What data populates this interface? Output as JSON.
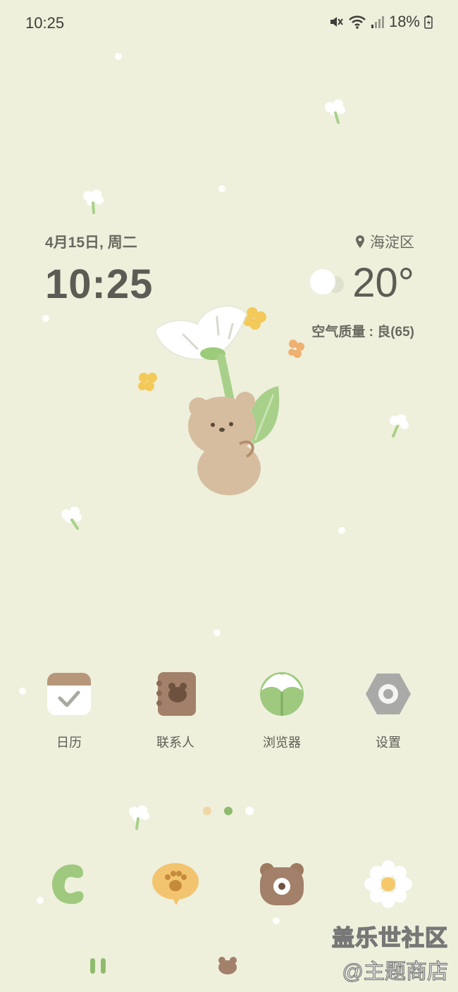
{
  "status_bar": {
    "time": "10:25",
    "battery": "18%",
    "icons": [
      "mute-icon",
      "wifi-icon",
      "signal-icon",
      "battery-charging-icon"
    ]
  },
  "widget": {
    "date": "4月15日, 周二",
    "time": "10:25",
    "location": "海淀区",
    "temperature": "20°",
    "air_quality": "空气质量 : 良(65)",
    "weather_icon": "partly-cloudy-icon"
  },
  "apps": [
    {
      "label": "日历",
      "icon": "calendar-icon"
    },
    {
      "label": "联系人",
      "icon": "contacts-icon"
    },
    {
      "label": "浏览器",
      "icon": "browser-icon"
    },
    {
      "label": "设置",
      "icon": "settings-icon"
    }
  ],
  "pages": {
    "count": 3,
    "active": 1
  },
  "dock": [
    {
      "icon": "phone-icon"
    },
    {
      "icon": "messages-icon"
    },
    {
      "icon": "camera-icon"
    },
    {
      "icon": "gallery-icon"
    }
  ],
  "watermark": {
    "line1": "盖乐世社区",
    "line2_at": "@",
    "line2": "主题商店"
  },
  "colors": {
    "background": "#eef0dc",
    "accent_green": "#8fbb6e",
    "dot_orange": "#f0d6a4"
  }
}
